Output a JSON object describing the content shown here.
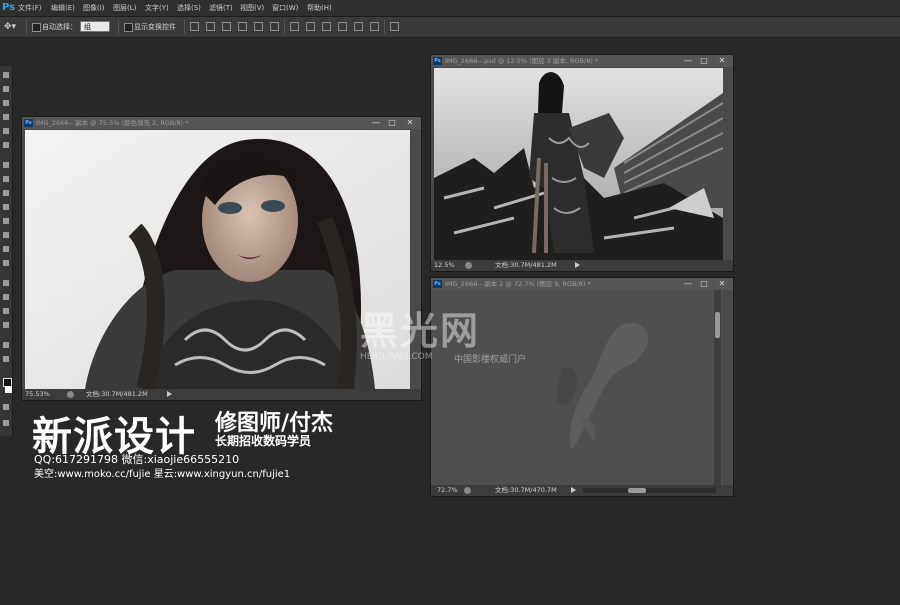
{
  "app": {
    "logo": "Ps"
  },
  "menu": [
    "文件(F)",
    "编辑(E)",
    "图像(I)",
    "图层(L)",
    "文字(Y)",
    "选择(S)",
    "滤镜(T)",
    "视图(V)",
    "窗口(W)",
    "帮助(H)"
  ],
  "options": {
    "auto_select_label": "自动选择：",
    "auto_select_value": "组",
    "show_transform_label": "显示变换控件"
  },
  "windows": {
    "left": {
      "title": "IMG_2666-- 副本 @ 75.5% (颜色填充 2, RGB/8) *",
      "zoom": "75.53%",
      "doc_info": "文档:30.7M/481.2M"
    },
    "top_right": {
      "title": "IMG_2666--.psd @ 12.5% (图层 3 副本, RGB/8) *",
      "zoom": "12.5%",
      "doc_info": "文档:30.7M/481.2M"
    },
    "bottom_right": {
      "title": "IMG_2666-- 副本 2 @ 72.7% (图层 9, RGB/8) *",
      "zoom": "72.7%",
      "doc_info": "文档:30.7M/470.7M"
    }
  },
  "window_buttons": {
    "minimize": "—",
    "maximize": "□",
    "close": "✕"
  },
  "branding": {
    "title": "新派设计",
    "subtitle": "修图师/付杰",
    "tagline": "长期招收数码学员",
    "qq_line": "QQ:617291798 微信:xiaojie66555210",
    "links_line": "美空:www.moko.cc/fujie 星云:www.xingyun.cn/fujie1"
  },
  "watermark": {
    "logo": "黑光网",
    "site": "HEIGUANG.COM",
    "slogan": "中国影楼权威门户"
  },
  "colors": {
    "accent_ps": "#2fa4e7",
    "workspace": "#282828",
    "panel": "#3a3a3a"
  }
}
